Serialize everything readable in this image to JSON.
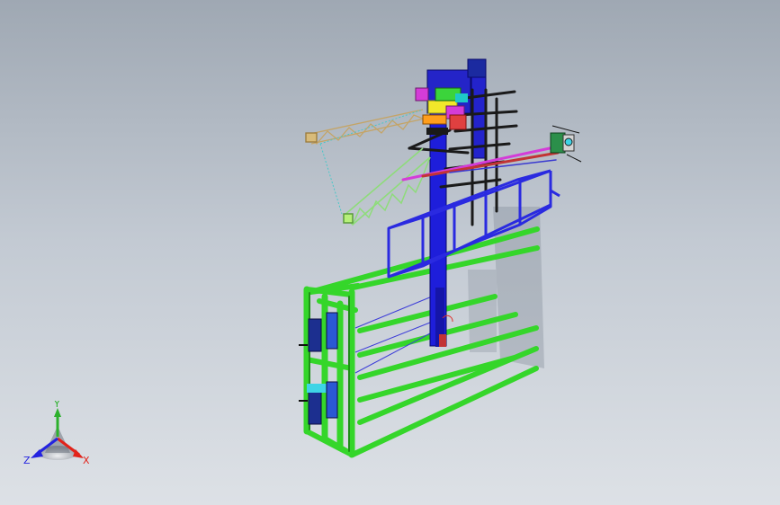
{
  "viewport": {
    "background_top": "#9fa8b3",
    "background_bottom": "#dde1e6"
  },
  "model": {
    "colors": {
      "frame_green": "#35d62a",
      "frame_green_dark": "#1f8f18",
      "column_blue": "#1e1eda",
      "cage_blue": "#2a2ae0",
      "crane_boom": "#c4a466",
      "crane_jib": "#8edc7a",
      "black_bars": "#1a1a1a",
      "magenta": "#d43cd8",
      "yellow": "#f2e82a",
      "cyan_cable": "#49c7c9",
      "red_arm": "#c23434",
      "shadow": "#7f8894"
    }
  },
  "triad": {
    "x_label": "X",
    "y_label": "Y",
    "z_label": "Z",
    "x_color": "#e2231a",
    "y_color": "#2cb02c",
    "z_color": "#2323e0"
  }
}
